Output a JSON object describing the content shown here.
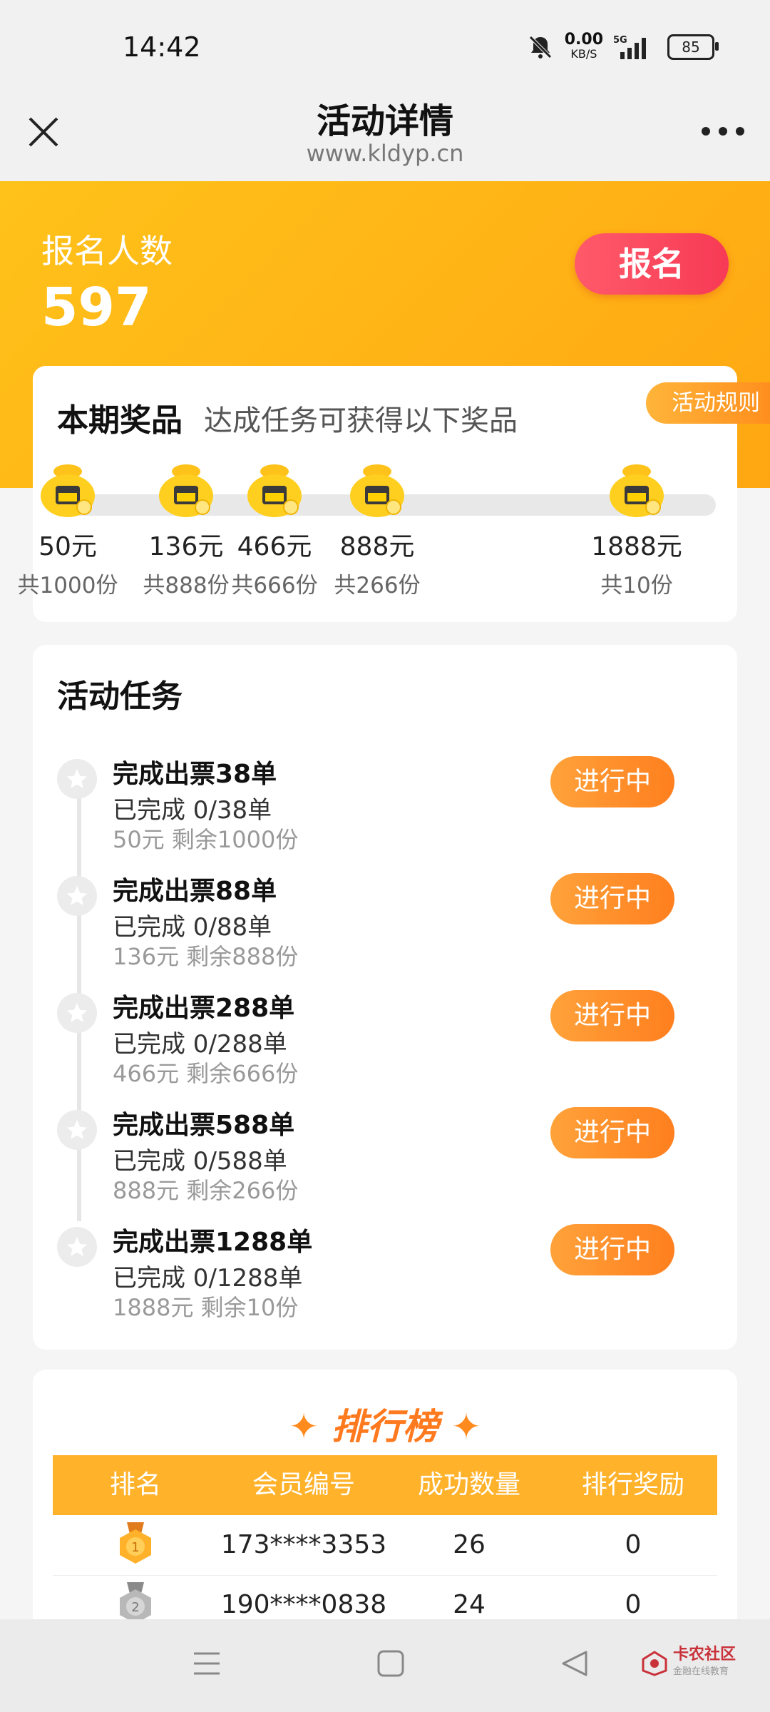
{
  "status_bar": {
    "time": "14:42",
    "speed_value": "0.00",
    "speed_unit": "KB/S",
    "network": "5G",
    "battery": "85"
  },
  "title_bar": {
    "title": "活动详情",
    "url": "www.kldyp.cn"
  },
  "hero": {
    "label": "报名人数",
    "count": "597",
    "signup_label": "报名"
  },
  "prizes": {
    "heading": "本期奖品",
    "subtitle": "达成任务可获得以下奖品",
    "rules_label": "活动规则",
    "items": [
      {
        "amount": "50元",
        "quantity": "共1000份"
      },
      {
        "amount": "136元",
        "quantity": "共888份"
      },
      {
        "amount": "466元",
        "quantity": "共666份"
      },
      {
        "amount": "888元",
        "quantity": "共266份"
      },
      {
        "amount": "1888元",
        "quantity": "共10份"
      }
    ]
  },
  "tasks": {
    "heading": "活动任务",
    "items": [
      {
        "name": "完成出票38单",
        "progress": "已完成 0/38单",
        "remaining": "50元 剩余1000份",
        "status": "进行中"
      },
      {
        "name": "完成出票88单",
        "progress": "已完成 0/88单",
        "remaining": "136元 剩余888份",
        "status": "进行中"
      },
      {
        "name": "完成出票288单",
        "progress": "已完成 0/288单",
        "remaining": "466元 剩余666份",
        "status": "进行中"
      },
      {
        "name": "完成出票588单",
        "progress": "已完成 0/588单",
        "remaining": "888元 剩余266份",
        "status": "进行中"
      },
      {
        "name": "完成出票1288单",
        "progress": "已完成 0/1288单",
        "remaining": "1888元 剩余10份",
        "status": "进行中"
      }
    ]
  },
  "ranking": {
    "title": "排行榜",
    "columns": [
      "排名",
      "会员编号",
      "成功数量",
      "排行奖励"
    ],
    "rows": [
      {
        "rank": "1",
        "member": "173****3353",
        "count": "26",
        "reward": "0"
      },
      {
        "rank": "2",
        "member": "190****0838",
        "count": "24",
        "reward": "0"
      }
    ]
  },
  "watermark": {
    "name": "卡农社区",
    "tagline": "金融在线教育"
  },
  "colors": {
    "brand_orange": "#ffb22a",
    "signup_red": "#f73a55",
    "status_orange": "#ff7f1e"
  }
}
